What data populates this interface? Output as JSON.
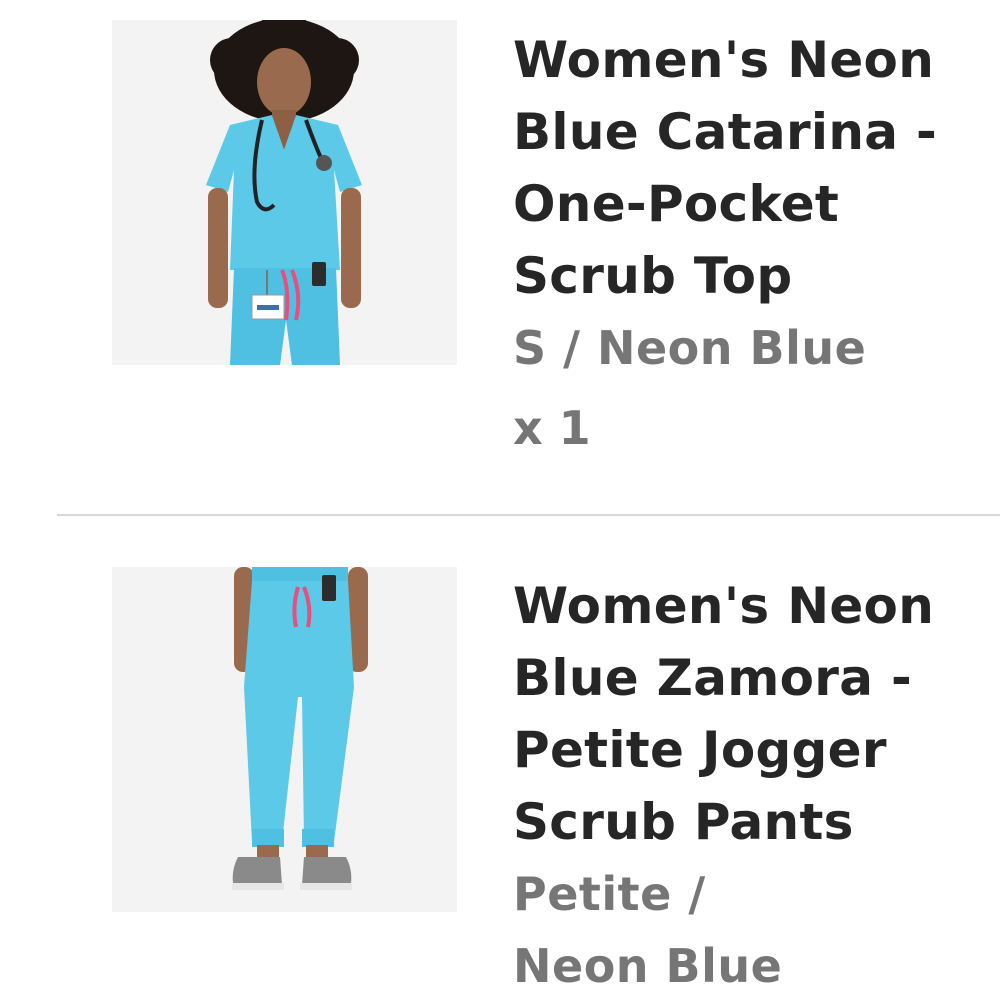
{
  "cart": {
    "items": [
      {
        "title_lines": [
          "Women's Neon",
          "Blue Catarina -",
          "One-Pocket",
          "Scrub Top"
        ],
        "variant_lines": [
          "S / Neon Blue"
        ],
        "quantity": "x 1",
        "image": "scrub-top-photo"
      },
      {
        "title_lines": [
          "Women's Neon",
          "Blue Zamora -",
          "Petite Jogger",
          "Scrub Pants"
        ],
        "variant_lines": [
          "Petite /",
          "Neon Blue"
        ],
        "image": "jogger-pants-photo"
      }
    ]
  },
  "colors": {
    "title": "#262626",
    "variant": "#767676",
    "scrub": "#5cc9e8",
    "divider": "#d6d6d6"
  }
}
